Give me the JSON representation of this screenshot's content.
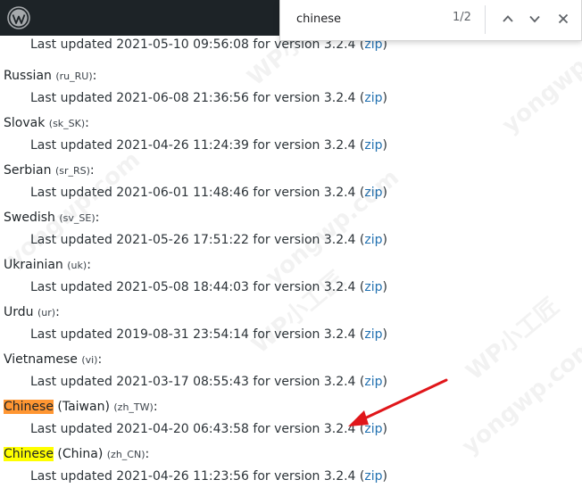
{
  "admin_bar": {
    "logo_icon": "wordpress-logo-icon"
  },
  "find_bar": {
    "query": "chinese",
    "match_count": "1/2",
    "prev_icon": "chevron-up-icon",
    "next_icon": "chevron-down-icon",
    "close_icon": "close-icon"
  },
  "top_entry": {
    "updated": "Last updated 2021-05-10 09:56:08 for version 3.2.4 (",
    "zip": "zip",
    "tail": ")"
  },
  "languages": [
    {
      "name": "Russian",
      "code": "(ru_RU)",
      "suffix": ":",
      "updated": "Last updated 2021-06-08 21:36:56 for version 3.2.4 (",
      "zip": "zip",
      "tail": ")"
    },
    {
      "name": "Slovak",
      "code": "(sk_SK)",
      "suffix": ":",
      "updated": "Last updated 2021-04-26 11:24:39 for version 3.2.4 (",
      "zip": "zip",
      "tail": ")"
    },
    {
      "name": "Serbian",
      "code": "(sr_RS)",
      "suffix": ":",
      "updated": "Last updated 2021-06-01 11:48:46 for version 3.2.4 (",
      "zip": "zip",
      "tail": ")"
    },
    {
      "name": "Swedish",
      "code": "(sv_SE)",
      "suffix": ":",
      "updated": "Last updated 2021-05-26 17:51:22 for version 3.2.4 (",
      "zip": "zip",
      "tail": ")"
    },
    {
      "name": "Ukrainian",
      "code": "(uk)",
      "suffix": ":",
      "updated": "Last updated 2021-05-08 18:44:03 for version 3.2.4 (",
      "zip": "zip",
      "tail": ")"
    },
    {
      "name": "Urdu",
      "code": "(ur)",
      "suffix": ":",
      "updated": "Last updated 2019-08-31 23:54:14 for version 3.2.4 (",
      "zip": "zip",
      "tail": ")"
    },
    {
      "name": "Vietnamese",
      "code": "(vi)",
      "suffix": ":",
      "updated": "Last updated 2021-03-17 08:55:43 for version 3.2.4 (",
      "zip": "zip",
      "tail": ")"
    }
  ],
  "chinese_taiwan": {
    "highlight": "Chinese",
    "rest": " (Taiwan)",
    "code": "(zh_TW)",
    "suffix": ":",
    "updated": "Last updated 2021-04-20 06:43:58 for version 3.2.4 (",
    "zip": "zip",
    "tail": ")"
  },
  "chinese_china": {
    "highlight": "Chinese",
    "rest": " (China)",
    "code": "(zh_CN)",
    "suffix": ":",
    "updated": "Last updated 2021-04-26 11:23:56 for version 3.2.4 (",
    "zip": "zip",
    "tail": ")"
  },
  "watermarks": [
    "WP小工匠",
    "yongwp.com"
  ],
  "colors": {
    "admin_bar": "#1d2327",
    "link": "#2271b1",
    "current_match": "#ff9632",
    "other_match": "#ffff00",
    "arrow": "#e0161a"
  }
}
